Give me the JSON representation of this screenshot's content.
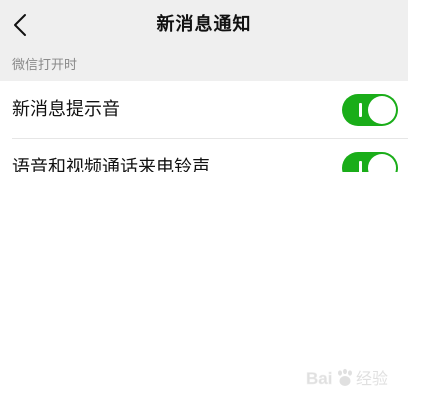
{
  "nav": {
    "title": "新消息通知"
  },
  "section": {
    "header": "微信打开时"
  },
  "settings": [
    {
      "label": "新消息提示音",
      "enabled": true
    },
    {
      "label": "语音和视频通话来电铃声",
      "enabled": true
    }
  ],
  "watermark": {
    "brand": "Baidu经验"
  },
  "colors": {
    "toggle_on": "#1aad19",
    "nav_background": "#efefef",
    "section_text": "#8a8a8a"
  }
}
